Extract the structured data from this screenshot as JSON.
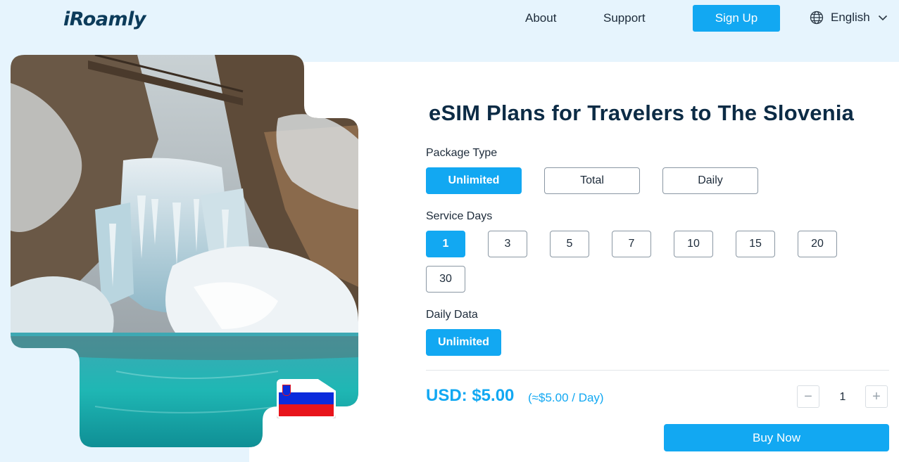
{
  "header": {
    "logo": "iRoamly",
    "nav": [
      {
        "label": "About"
      },
      {
        "label": "Support"
      }
    ],
    "signup_label": "Sign Up",
    "language": "English"
  },
  "main": {
    "title": "eSIM Plans for Travelers to The Slovenia",
    "package_type": {
      "label": "Package Type",
      "options": [
        "Unlimited",
        "Total",
        "Daily"
      ],
      "selected": "Unlimited"
    },
    "service_days": {
      "label": "Service Days",
      "options": [
        "1",
        "3",
        "5",
        "7",
        "10",
        "15",
        "20",
        "30"
      ],
      "selected": "1"
    },
    "daily_data": {
      "label": "Daily Data",
      "options": [
        "Unlimited"
      ],
      "selected": "Unlimited"
    },
    "price": "USD: $5.00",
    "per_day": "(≈$5.00 / Day)",
    "quantity": "1",
    "minus": "−",
    "plus": "+",
    "buy_label": "Buy Now"
  },
  "icons": {
    "globe": "globe-icon",
    "chevron": "chevron-down-icon"
  },
  "colors": {
    "accent": "#12a8f2",
    "page_bg": "#e6f4fd",
    "heading": "#0c2b45"
  }
}
